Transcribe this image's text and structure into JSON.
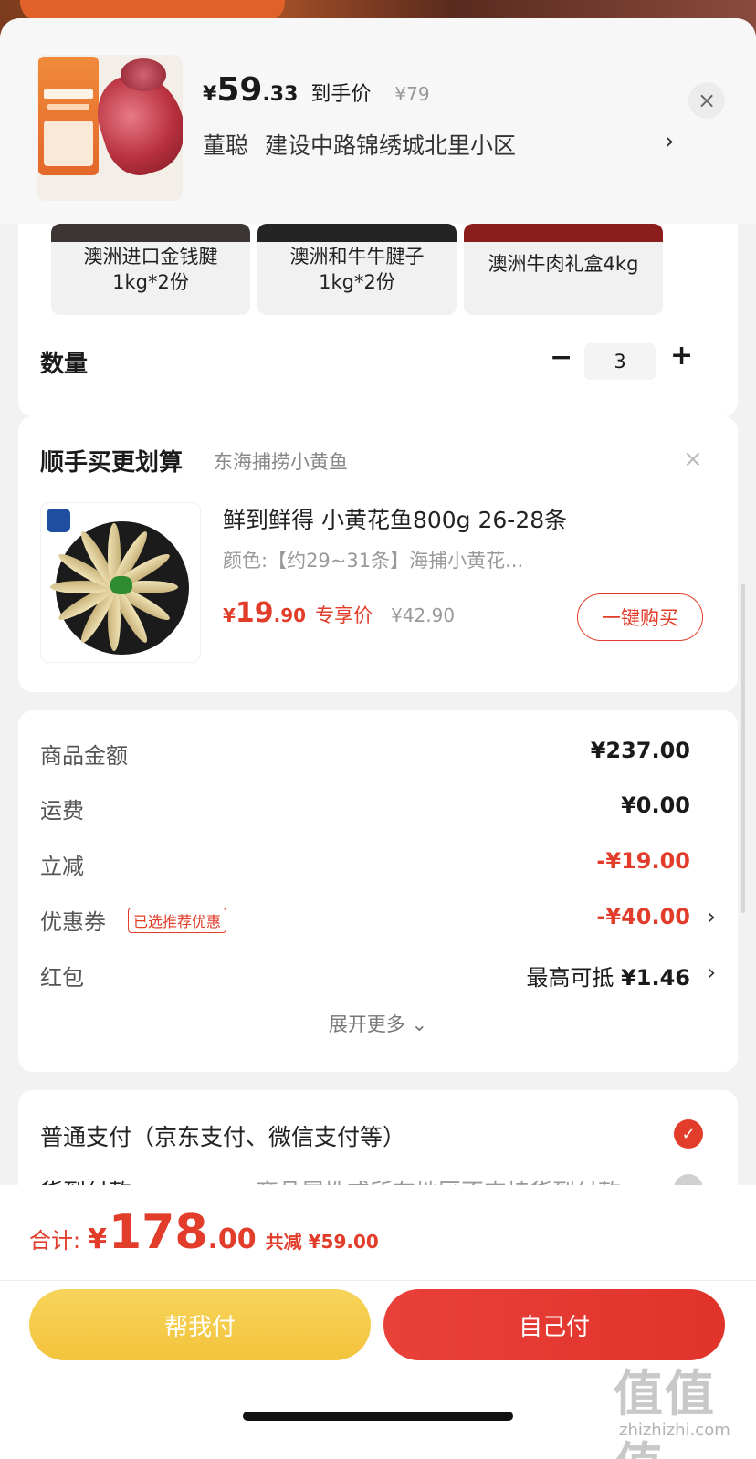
{
  "header": {
    "price_currency": "¥",
    "price_int": "59",
    "price_dec": ".33",
    "price_label": "到手价",
    "orig_price": "¥79",
    "recipient": "董聪",
    "address": "建设中路锦绣城北里小区",
    "address_chevron": "›",
    "close_glyph": "×"
  },
  "variants": [
    {
      "label": "澳洲进口金钱腱\n1kg*2份"
    },
    {
      "label": "澳洲和牛牛腱子\n1kg*2份"
    },
    {
      "label": "澳洲牛肉礼盒4kg"
    }
  ],
  "quantity": {
    "label": "数量",
    "minus": "−",
    "value": "3",
    "plus": "+"
  },
  "upsell": {
    "title": "顺手买更划算",
    "subtitle": "东海捕捞小黄鱼",
    "close_glyph": "×",
    "product_name": "鲜到鲜得 小黄花鱼800g 26-28条",
    "spec": "颜色:【约29~31条】海捕小黄花...",
    "price_currency": "¥",
    "price_int": "19",
    "price_dec": ".90",
    "price_label": "专享价",
    "orig_price": "¥42.90",
    "buy_label": "一键购买"
  },
  "summary": {
    "rows": [
      {
        "key": "商品金额",
        "value": "¥237.00"
      },
      {
        "key": "运费",
        "value": "¥0.00"
      },
      {
        "key": "立减",
        "value": "-¥19.00"
      },
      {
        "key": "优惠券",
        "value": "-¥40.00",
        "tag": "已选推荐优惠"
      },
      {
        "key": "红包",
        "value_prefix": "最高可抵",
        "value": "¥1.46"
      }
    ],
    "chevron": "›",
    "expand_label": "展开更多 ⌄"
  },
  "payment": {
    "option1": "普通支付（京东支付、微信支付等）",
    "option2": "货到付款",
    "option2_note": "商品属性或所在地区不支持货到付款",
    "check_glyph": "✓"
  },
  "bottom": {
    "total_label": "合计:",
    "total_currency": "¥",
    "total_int": "178",
    "total_dec": ".00",
    "saved": "共减 ¥59.00",
    "help_pay": "帮我付",
    "self_pay": "自己付"
  },
  "watermark": {
    "big": "值值值",
    "small": "zhizhizhi.com"
  },
  "colors": {
    "accent": "#e23c2a",
    "help_btn": "#f3c33c",
    "self_btn": "#e0332a"
  }
}
